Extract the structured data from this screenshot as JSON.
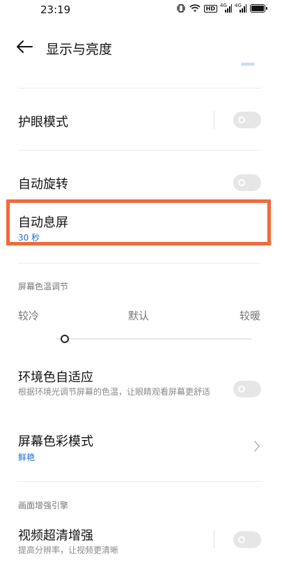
{
  "status_bar": {
    "time": "23:19",
    "hd_label": "HD",
    "sig1_label": "4G",
    "sig2_label": "4G"
  },
  "header": {
    "title": "显示与亮度"
  },
  "rows": {
    "eye_protection": {
      "title": "护眼模式"
    },
    "auto_rotate": {
      "title": "自动旋转"
    },
    "screen_timeout": {
      "title": "自动息屏",
      "value": "30 秒"
    },
    "color_temp_section": {
      "label": "屏幕色温调节"
    },
    "color_temp": {
      "cool": "较冷",
      "default": "默认",
      "warm": "较暖",
      "level": 0.05
    },
    "ambient_adapt": {
      "title": "环境色自适应",
      "subtitle": "根据环境光调节屏幕的色温，让眼睛观看屏幕更舒适"
    },
    "color_mode": {
      "title": "屏幕色彩模式",
      "value": "鲜艳"
    },
    "enhance_section": {
      "label": "画面增强引擎"
    },
    "video_enhance": {
      "title": "视频超清增强",
      "subtitle": "提高分辨率，让视频更清晰"
    }
  },
  "colors": {
    "accent": "#1e6bd6",
    "highlight": "#f06a3a",
    "toggle_off": "#e6e6e6"
  }
}
